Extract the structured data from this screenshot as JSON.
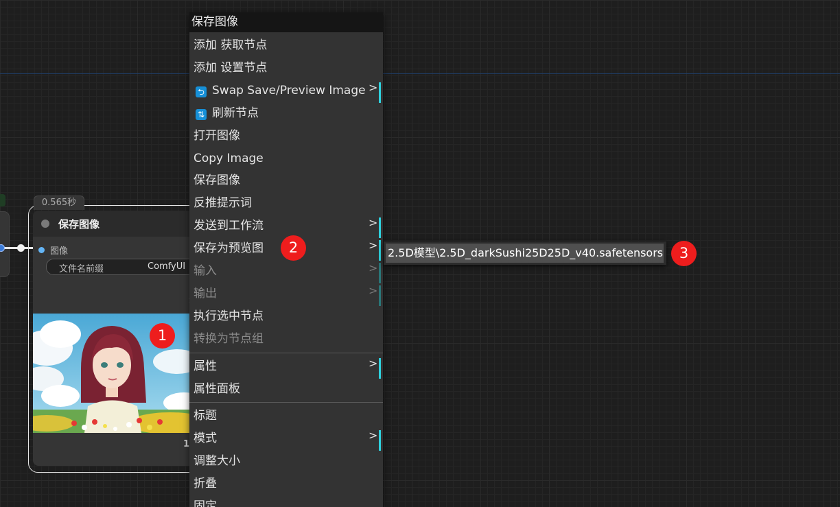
{
  "node": {
    "exec_time": "0.565秒",
    "title": "保存图像",
    "input_label": "图像",
    "widget_label": "文件名前缀",
    "widget_value": "ComfyUI",
    "footer": "1"
  },
  "menu": {
    "title": "保存图像",
    "items": [
      {
        "label": "添加 获取节点"
      },
      {
        "label": "添加 设置节点"
      },
      {
        "label": "Swap Save/Preview Image",
        "icon": "swap-icon",
        "submenu": true
      },
      {
        "label": "刷新节点",
        "icon": "refresh-icon"
      },
      {
        "label": "打开图像"
      },
      {
        "label": "Copy Image"
      },
      {
        "label": "保存图像"
      },
      {
        "label": "反推提示词"
      },
      {
        "label": "发送到工作流",
        "submenu": true
      },
      {
        "label": "保存为预览图",
        "submenu": true
      },
      {
        "label": "输入",
        "submenu": true,
        "disabled": true
      },
      {
        "label": "输出",
        "submenu": true,
        "disabled": true
      },
      {
        "label": "执行选中节点"
      },
      {
        "label": "转换为节点组",
        "disabled": true
      },
      {
        "label": "属性",
        "submenu": true
      },
      {
        "label": "属性面板"
      },
      {
        "label": "标题"
      },
      {
        "label": "模式",
        "submenu": true
      },
      {
        "label": "调整大小"
      },
      {
        "label": "折叠"
      },
      {
        "label": "固定"
      }
    ],
    "arrow": ">"
  },
  "submenu": {
    "item": "2.5D模型\\2.5D_darkSushi25D25D_v40.safetensors"
  },
  "badges": [
    "1",
    "2",
    "3"
  ],
  "colors": {
    "accent_bar": "#2fd3df",
    "badge": "#ee1d1d",
    "icon_blue": "#1690d8"
  }
}
